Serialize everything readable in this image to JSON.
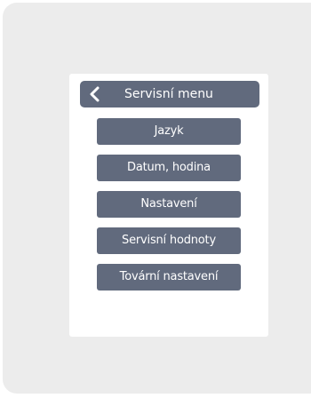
{
  "header": {
    "back_icon": "chevron-left-icon",
    "title": "Servisní menu"
  },
  "menu": {
    "items": [
      {
        "label": "Jazyk"
      },
      {
        "label": "Datum, hodina"
      },
      {
        "label": "Nastavení"
      },
      {
        "label": "Servisní hodnoty"
      },
      {
        "label": "Tovární nastavení"
      }
    ]
  },
  "colors": {
    "device_background": "#ececec",
    "screen_background": "#ffffff",
    "button_fill": "#616a7d",
    "button_text": "#ffffff"
  }
}
